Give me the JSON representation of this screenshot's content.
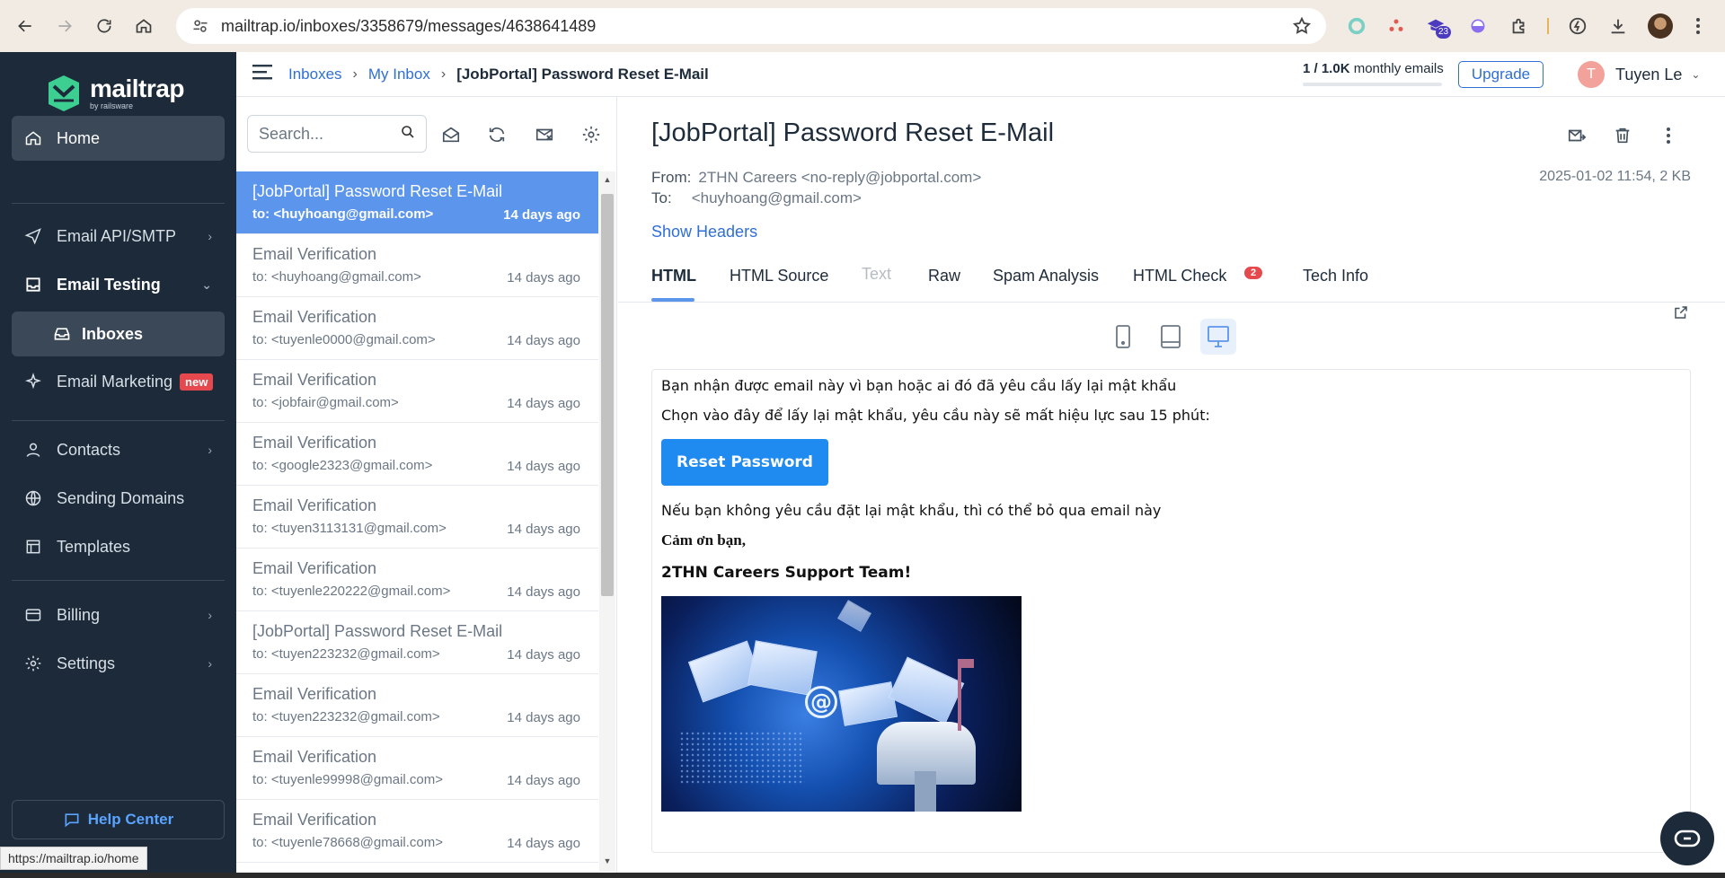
{
  "browser": {
    "url": "mailtrap.io/inboxes/3358679/messages/4638641489",
    "ext_badge": "23",
    "status_url": "https://mailtrap.io/home"
  },
  "brand": {
    "name": "mailtrap",
    "tagline": "by railsware",
    "accent": "#3ccf91"
  },
  "sidebar": {
    "items": [
      {
        "label": "Home",
        "icon": "home-icon"
      },
      {
        "label": "Email API/SMTP",
        "icon": "send-icon"
      },
      {
        "label": "Email Testing",
        "icon": "inbox-tray-icon"
      },
      {
        "label": "Inboxes",
        "icon": "inbox-icon"
      },
      {
        "label": "Email Marketing",
        "icon": "sparkle-icon",
        "badge": "new"
      },
      {
        "label": "Contacts",
        "icon": "user-icon"
      },
      {
        "label": "Sending Domains",
        "icon": "globe-icon"
      },
      {
        "label": "Templates",
        "icon": "template-icon"
      },
      {
        "label": "Billing",
        "icon": "card-icon"
      },
      {
        "label": "Settings",
        "icon": "gear-icon"
      }
    ],
    "help": "Help Center"
  },
  "topbar": {
    "breadcrumb": [
      "Inboxes",
      "My Inbox",
      "[JobPortal] Password Reset E-Mail"
    ],
    "quota_used": "1 / 1.0K",
    "quota_label": "monthly emails",
    "quota_fraction": 0.001,
    "upgrade": "Upgrade",
    "user_initial": "T",
    "user_name": "Tuyen Le"
  },
  "list": {
    "search_placeholder": "Search...",
    "messages": [
      {
        "subject": "[JobPortal] Password Reset E-Mail",
        "to": "to: <huyhoang@gmail.com>",
        "age": "14 days ago",
        "selected": true
      },
      {
        "subject": "Email Verification",
        "to": "to: <huyhoang@gmail.com>",
        "age": "14 days ago"
      },
      {
        "subject": "Email Verification",
        "to": "to: <tuyenle0000@gmail.com>",
        "age": "14 days ago"
      },
      {
        "subject": "Email Verification",
        "to": "to: <jobfair@gmail.com>",
        "age": "14 days ago"
      },
      {
        "subject": "Email Verification",
        "to": "to: <google2323@gmail.com>",
        "age": "14 days ago"
      },
      {
        "subject": "Email Verification",
        "to": "to: <tuyen3113131@gmail.com>",
        "age": "14 days ago"
      },
      {
        "subject": "Email Verification",
        "to": "to: <tuyenle220222@gmail.com>",
        "age": "14 days ago"
      },
      {
        "subject": "[JobPortal] Password Reset E-Mail",
        "to": "to: <tuyen223232@gmail.com>",
        "age": "14 days ago"
      },
      {
        "subject": "Email Verification",
        "to": "to: <tuyen223232@gmail.com>",
        "age": "14 days ago"
      },
      {
        "subject": "Email Verification",
        "to": "to: <tuyenle99998@gmail.com>",
        "age": "14 days ago"
      },
      {
        "subject": "Email Verification",
        "to": "to: <tuyenle78668@gmail.com>",
        "age": "14 days ago"
      }
    ]
  },
  "message": {
    "title": "[JobPortal] Password Reset E-Mail",
    "from_label": "From:",
    "from": "2THN Careers <no-reply@jobportal.com>",
    "to_label": "To:",
    "to": "<huyhoang@gmail.com>",
    "meta": "2025-01-02 11:54, 2 KB",
    "show_headers": "Show Headers",
    "tabs": [
      "HTML",
      "HTML Source",
      "Text",
      "Raw",
      "Spam Analysis",
      "HTML Check",
      "Tech Info"
    ],
    "html_check_count": "2",
    "body": {
      "line1": "Bạn nhận được email này vì bạn hoặc ai đó đã yêu cầu lấy lại mật khẩu",
      "line2": "Chọn vào đây để lấy lại mật khẩu, yêu cầu này sẽ mất hiệu lực sau 15 phút:",
      "button": "Reset Password",
      "line3": "Nếu bạn không yêu cầu đặt lại mật khẩu, thì có thể bỏ qua email này",
      "thanks": "Cảm ơn bạn,",
      "signature": "2THN Careers Support Team!"
    }
  }
}
